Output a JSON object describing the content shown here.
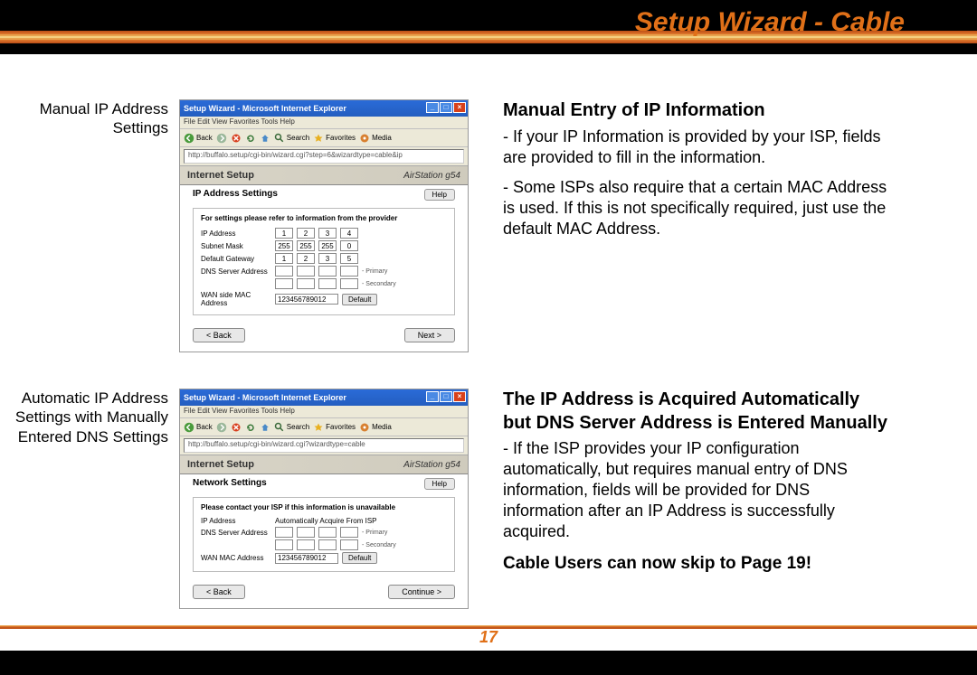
{
  "page": {
    "title": "Setup Wizard - Cable",
    "number": "17"
  },
  "row1": {
    "caption": "Manual IP Address Settings",
    "heading": "Manual Entry of IP Information",
    "para1": "- If your IP Information is provided by your ISP, fields are provided to fill in the information.",
    "para2": "- Some ISPs also require that a certain MAC Address is used. If this is not specifically required, just use the default MAC Address.",
    "screenshot": {
      "window_title": "Setup Wizard - Microsoft Internet Explorer",
      "menu": "File  Edit  View  Favorites  Tools  Help",
      "nav_back": "Back",
      "search": "Search",
      "favorites": "Favorites",
      "media": "Media",
      "address": "http://buffalo.setup/cgi-bin/wizard.cgi?step=6&wizardtype=cable&ip",
      "band_left": "Internet Setup",
      "band_right": "AirStation g54",
      "subhead": "IP Address Settings",
      "help": "Help",
      "form_note": "For settings please refer to information from the provider",
      "labels": {
        "ip": "IP Address",
        "mask": "Subnet Mask",
        "gw": "Default Gateway",
        "dns": "DNS Server Address",
        "mac": "WAN side MAC Address"
      },
      "ip": [
        "1",
        "2",
        "3",
        "4"
      ],
      "mask": [
        "255",
        "255",
        "255",
        "0"
      ],
      "gw": [
        "1",
        "2",
        "3",
        "5"
      ],
      "dns_primary": "- Primary",
      "dns_secondary": "- Secondary",
      "mac_value": "123456789012",
      "default_btn": "Default",
      "back": "< Back",
      "next": "Next >"
    }
  },
  "row2": {
    "caption": "Automatic IP Address Settings with Manually Entered DNS Settings",
    "heading": "The IP Address is Acquired Automatically but DNS Server Address is Entered Manually",
    "para1": "- If the ISP provides your IP configuration automatically, but requires manual entry of DNS information, fields will be provided for DNS information after an IP Address is successfully acquired.",
    "skip": "Cable Users can now skip to Page 19!",
    "screenshot": {
      "window_title": "Setup Wizard - Microsoft Internet Explorer",
      "menu": "File  Edit  View  Favorites  Tools  Help",
      "nav_back": "Back",
      "search": "Search",
      "favorites": "Favorites",
      "media": "Media",
      "address": "http://buffalo.setup/cgi-bin/wizard.cgi?wizardtype=cable",
      "band_left": "Internet Setup",
      "band_right": "AirStation g54",
      "subhead": "Network Settings",
      "help": "Help",
      "form_note": "Please contact your ISP if this information is unavailable",
      "labels": {
        "ip": "IP Address",
        "dns": "DNS Server Address",
        "mac": "WAN MAC Address"
      },
      "ip_value": "Automatically Acquire From ISP",
      "dns_primary": "- Primary",
      "dns_secondary": "- Secondary",
      "mac_value": "123456789012",
      "default_btn": "Default",
      "back": "< Back",
      "next": "Continue >"
    }
  }
}
